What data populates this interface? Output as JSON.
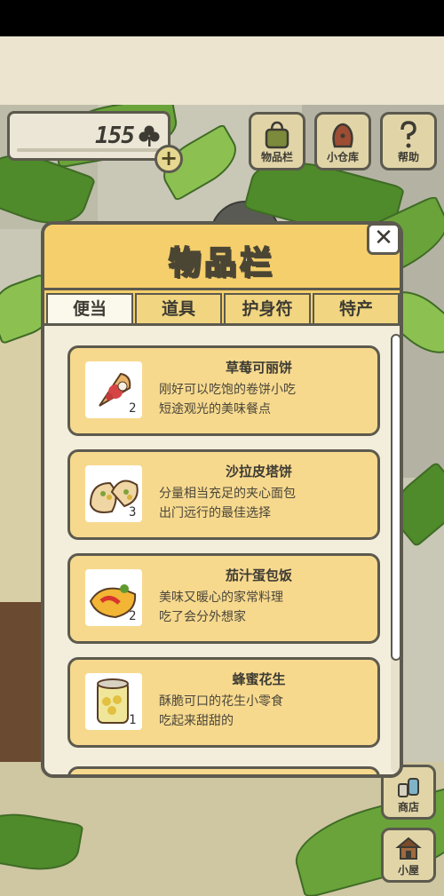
{
  "header": {
    "clover_count": "155",
    "clover_icon": "clover-icon",
    "plus_label": "+"
  },
  "top_buttons": [
    {
      "label": "物品栏",
      "icon": "bag-icon"
    },
    {
      "label": "小仓库",
      "icon": "storage-sack-icon"
    },
    {
      "label": "帮助",
      "icon": "question-icon"
    }
  ],
  "side_buttons": [
    {
      "label": "商店",
      "icon": "shop-icon"
    },
    {
      "label": "小屋",
      "icon": "house-icon"
    }
  ],
  "dialog": {
    "title": "物品栏",
    "close_label": "✕",
    "tabs": [
      {
        "label": "便当",
        "active": true
      },
      {
        "label": "道具",
        "active": false
      },
      {
        "label": "护身符",
        "active": false
      },
      {
        "label": "特产",
        "active": false
      }
    ],
    "items": [
      {
        "name": "草莓可丽饼",
        "desc": "刚好可以吃饱的卷饼小吃\n短途观光的美味餐点",
        "qty": "2",
        "icon": "crepe-icon"
      },
      {
        "name": "沙拉皮塔饼",
        "desc": "分量相当充足的夹心面包\n出门远行的最佳选择",
        "qty": "3",
        "icon": "pita-icon"
      },
      {
        "name": "茄汁蛋包饭",
        "desc": "美味又暖心的家常料理\n吃了会分外想家",
        "qty": "2",
        "icon": "omurice-icon"
      },
      {
        "name": "蜂蜜花生",
        "desc": "酥脆可口的花生小零食\n吃起来甜甜的",
        "qty": "1",
        "icon": "peanut-can-icon"
      }
    ]
  },
  "colors": {
    "accent": "#f5cf6c",
    "item_bg": "#f7d98e",
    "border": "#5c5a4e",
    "panel_bg": "#f3eedc"
  }
}
